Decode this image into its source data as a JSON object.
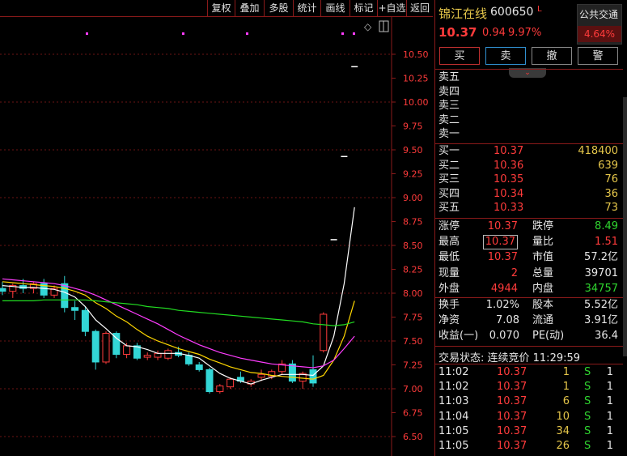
{
  "toolbar": {
    "buttons": [
      "复权",
      "叠加",
      "多股",
      "统计",
      "画线",
      "标记",
      "+自选",
      "返回"
    ]
  },
  "chart": {
    "price_axis_labels": [
      "10.50",
      "10.25",
      "10.00",
      "9.75",
      "9.50",
      "9.25",
      "9.00",
      "8.75",
      "8.50",
      "8.25",
      "8.00",
      "7.75",
      "7.50",
      "7.25",
      "7.00",
      "6.75",
      "6.50"
    ],
    "colors": {
      "up": "#ff3b3b",
      "down": "#33d6d6",
      "ma5": "#ffffff",
      "ma10": "#ffd700",
      "ma20": "#ff3cff",
      "ma60": "#22dd22"
    }
  },
  "chart_data": {
    "type": "candlestick",
    "ylim": [
      6.45,
      10.6
    ],
    "candles": [
      {
        "o": 8.05,
        "h": 8.12,
        "l": 7.98,
        "c": 8.02
      },
      {
        "o": 8.02,
        "h": 8.1,
        "l": 7.95,
        "c": 8.08
      },
      {
        "o": 8.08,
        "h": 8.15,
        "l": 8.0,
        "c": 8.05
      },
      {
        "o": 8.05,
        "h": 8.12,
        "l": 8.0,
        "c": 8.1
      },
      {
        "o": 8.1,
        "h": 8.15,
        "l": 7.95,
        "c": 7.98
      },
      {
        "o": 7.98,
        "h": 8.08,
        "l": 7.95,
        "c": 8.05
      },
      {
        "o": 8.1,
        "h": 8.18,
        "l": 7.8,
        "c": 7.85
      },
      {
        "o": 7.85,
        "h": 7.92,
        "l": 7.72,
        "c": 7.82
      },
      {
        "o": 7.82,
        "h": 7.86,
        "l": 7.55,
        "c": 7.6
      },
      {
        "o": 7.6,
        "h": 7.62,
        "l": 7.2,
        "c": 7.28
      },
      {
        "o": 7.28,
        "h": 7.6,
        "l": 7.26,
        "c": 7.58
      },
      {
        "o": 7.58,
        "h": 7.6,
        "l": 7.32,
        "c": 7.36
      },
      {
        "o": 7.36,
        "h": 7.48,
        "l": 7.32,
        "c": 7.45
      },
      {
        "o": 7.45,
        "h": 7.48,
        "l": 7.3,
        "c": 7.32
      },
      {
        "o": 7.33,
        "h": 7.38,
        "l": 7.3,
        "c": 7.35
      },
      {
        "o": 7.33,
        "h": 7.4,
        "l": 7.3,
        "c": 7.37
      },
      {
        "o": 7.32,
        "h": 7.42,
        "l": 7.3,
        "c": 7.4
      },
      {
        "o": 7.38,
        "h": 7.44,
        "l": 7.33,
        "c": 7.35
      },
      {
        "o": 7.35,
        "h": 7.38,
        "l": 7.24,
        "c": 7.26
      },
      {
        "o": 7.25,
        "h": 7.28,
        "l": 7.18,
        "c": 7.2
      },
      {
        "o": 7.2,
        "h": 7.22,
        "l": 6.95,
        "c": 6.97
      },
      {
        "o": 6.97,
        "h": 7.05,
        "l": 6.95,
        "c": 7.03
      },
      {
        "o": 7.02,
        "h": 7.12,
        "l": 7.0,
        "c": 7.1
      },
      {
        "o": 7.12,
        "h": 7.18,
        "l": 7.06,
        "c": 7.08
      },
      {
        "o": 7.05,
        "h": 7.1,
        "l": 7.02,
        "c": 7.08
      },
      {
        "o": 7.12,
        "h": 7.2,
        "l": 7.08,
        "c": 7.15
      },
      {
        "o": 7.13,
        "h": 7.2,
        "l": 7.1,
        "c": 7.18
      },
      {
        "o": 7.18,
        "h": 7.3,
        "l": 7.15,
        "c": 7.26
      },
      {
        "o": 7.26,
        "h": 7.3,
        "l": 7.06,
        "c": 7.08
      },
      {
        "o": 7.08,
        "h": 7.18,
        "l": 7.0,
        "c": 7.16
      },
      {
        "o": 7.2,
        "h": 7.35,
        "l": 7.02,
        "c": 7.06
      },
      {
        "o": 7.4,
        "h": 7.8,
        "l": 7.38,
        "c": 7.78
      },
      {
        "o": 8.56,
        "h": 8.56,
        "l": 8.56,
        "c": 8.56
      },
      {
        "o": 9.43,
        "h": 9.43,
        "l": 9.43,
        "c": 9.43
      },
      {
        "o": 10.37,
        "h": 10.37,
        "l": 10.37,
        "c": 10.37
      }
    ],
    "ma": [
      {
        "name": "MA5",
        "values": [
          8.08,
          8.07,
          8.06,
          8.06,
          8.05,
          8.04,
          8.01,
          7.96,
          7.86,
          7.72,
          7.63,
          7.53,
          7.45,
          7.44,
          7.41,
          7.37,
          7.37,
          7.37,
          7.35,
          7.32,
          7.24,
          7.16,
          7.11,
          7.08,
          7.05,
          7.09,
          7.12,
          7.15,
          7.15,
          7.15,
          7.14,
          7.24,
          7.55,
          8.1,
          8.9
        ]
      },
      {
        "name": "MA10",
        "values": [
          8.12,
          8.11,
          8.1,
          8.09,
          8.08,
          8.07,
          8.05,
          8.02,
          7.98,
          7.9,
          7.84,
          7.76,
          7.7,
          7.62,
          7.55,
          7.5,
          7.46,
          7.42,
          7.39,
          7.36,
          7.31,
          7.27,
          7.23,
          7.2,
          7.17,
          7.16,
          7.14,
          7.13,
          7.12,
          7.11,
          7.1,
          7.14,
          7.3,
          7.55,
          7.92
        ]
      },
      {
        "name": "MA20",
        "values": [
          8.15,
          8.14,
          8.13,
          8.12,
          8.11,
          8.1,
          8.08,
          8.05,
          8.02,
          7.98,
          7.93,
          7.88,
          7.83,
          7.78,
          7.73,
          7.68,
          7.62,
          7.56,
          7.51,
          7.46,
          7.42,
          7.38,
          7.35,
          7.32,
          7.3,
          7.28,
          7.26,
          7.25,
          7.24,
          7.23,
          7.22,
          7.24,
          7.3,
          7.42,
          7.55
        ]
      },
      {
        "name": "MA60",
        "values": [
          7.92,
          7.92,
          7.92,
          7.92,
          7.93,
          7.93,
          7.93,
          7.93,
          7.93,
          7.92,
          7.91,
          7.9,
          7.89,
          7.88,
          7.86,
          7.85,
          7.84,
          7.82,
          7.81,
          7.8,
          7.79,
          7.78,
          7.77,
          7.76,
          7.75,
          7.74,
          7.73,
          7.72,
          7.71,
          7.7,
          7.68,
          7.67,
          7.66,
          7.67,
          7.7
        ]
      }
    ]
  },
  "stock": {
    "name": "锦江在线",
    "code": "600650",
    "flag": "L",
    "price": "10.37",
    "change": "0.94",
    "change_pct": "9.97%",
    "sector": "公共交通",
    "sector_pct": "4.64%"
  },
  "trade_buttons": [
    "买",
    "卖",
    "撤",
    "警"
  ],
  "asks": [
    {
      "label": "卖五",
      "price": "",
      "vol": ""
    },
    {
      "label": "卖四",
      "price": "",
      "vol": ""
    },
    {
      "label": "卖三",
      "price": "",
      "vol": ""
    },
    {
      "label": "卖二",
      "price": "",
      "vol": ""
    },
    {
      "label": "卖一",
      "price": "",
      "vol": ""
    }
  ],
  "bids": [
    {
      "label": "买一",
      "price": "10.37",
      "vol": "418400"
    },
    {
      "label": "买二",
      "price": "10.36",
      "vol": "639"
    },
    {
      "label": "买三",
      "price": "10.35",
      "vol": "76"
    },
    {
      "label": "买四",
      "price": "10.34",
      "vol": "36"
    },
    {
      "label": "买五",
      "price": "10.33",
      "vol": "73"
    }
  ],
  "quote": {
    "limit_up_label": "涨停",
    "limit_up": "10.37",
    "limit_down_label": "跌停",
    "limit_down": "8.49",
    "high_label": "最高",
    "high": "10.37",
    "vol_ratio_label": "量比",
    "vol_ratio": "1.51",
    "low_label": "最低",
    "low": "10.37",
    "mktcap_label": "市值",
    "mktcap": "57.2亿",
    "cur_label": "现量",
    "cur": "2",
    "total_vol_label": "总量",
    "total_vol": "39701",
    "outer_label": "外盘",
    "outer": "4944",
    "inner_label": "内盘",
    "inner": "34757"
  },
  "fundamentals": {
    "turnover_label": "换手",
    "turnover": "1.02%",
    "shares_label": "股本",
    "shares": "5.52亿",
    "nav_label": "净资",
    "nav": "7.08",
    "float_label": "流通",
    "float": "3.91亿",
    "eps_label": "收益(一)",
    "eps": "0.070",
    "pe_label": "PE(动)",
    "pe": "36.4"
  },
  "status": "交易状态: 连续竞价 11:29:59",
  "ticks": [
    {
      "time": "11:02",
      "price": "10.37",
      "vol": "1",
      "side": "S",
      "n": "1"
    },
    {
      "time": "11:02",
      "price": "10.37",
      "vol": "1",
      "side": "S",
      "n": "1"
    },
    {
      "time": "11:03",
      "price": "10.37",
      "vol": "6",
      "side": "S",
      "n": "1"
    },
    {
      "time": "11:04",
      "price": "10.37",
      "vol": "10",
      "side": "S",
      "n": "1"
    },
    {
      "time": "11:05",
      "price": "10.37",
      "vol": "34",
      "side": "S",
      "n": "1"
    },
    {
      "time": "11:05",
      "price": "10.37",
      "vol": "26",
      "side": "S",
      "n": "1"
    }
  ]
}
